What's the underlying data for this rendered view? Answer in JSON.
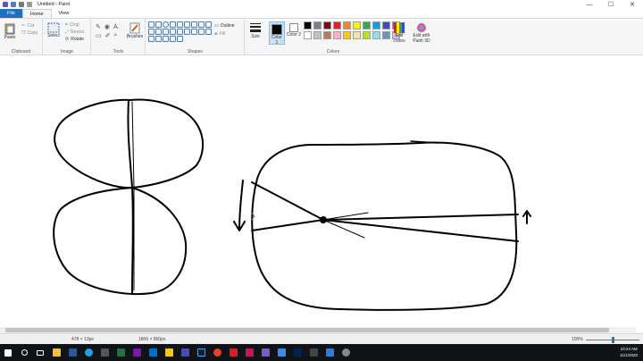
{
  "window": {
    "title": "Untitled - Paint",
    "minimize": "—",
    "maximize": "☐",
    "close": "✕"
  },
  "tabs": [
    {
      "label": "File"
    },
    {
      "label": "Home"
    },
    {
      "label": "View"
    }
  ],
  "clipboard": {
    "paste": "Paste",
    "cut": "Cut",
    "copy": "Copy",
    "label": "Clipboard"
  },
  "image": {
    "select": "Select",
    "crop": "Crop",
    "resize": "Resize",
    "rotate": "Rotate",
    "label": "Image"
  },
  "tools": {
    "label": "Tools",
    "brushes": "Brushes"
  },
  "shapes": {
    "label": "Shapes",
    "outline": "Outline",
    "fill": "Fill"
  },
  "size": {
    "label": "Size"
  },
  "colors": {
    "color1": "Color 1",
    "color2": "Color 2",
    "label": "Colors",
    "edit_colors": "Edit colors",
    "edit_paint3d": "Edit with Paint 3D",
    "palette_row1": [
      "#000000",
      "#7f7f7f",
      "#880015",
      "#ed1c24",
      "#ff7f27",
      "#fff200",
      "#22b14c",
      "#00a2e8",
      "#3f48cc",
      "#a349a4"
    ],
    "palette_row2": [
      "#ffffff",
      "#c3c3c3",
      "#b97a57",
      "#ffaec9",
      "#ffc90e",
      "#efe4b0",
      "#b5e61d",
      "#99d9ea",
      "#7092be",
      "#c8bfe7"
    ]
  },
  "status": {
    "cursor": "478 × 13px",
    "canvas_size": "1806 × 860px",
    "zoom": "100%"
  },
  "taskbar": {
    "time": "10:24 AM",
    "date": "11/1/2020"
  }
}
